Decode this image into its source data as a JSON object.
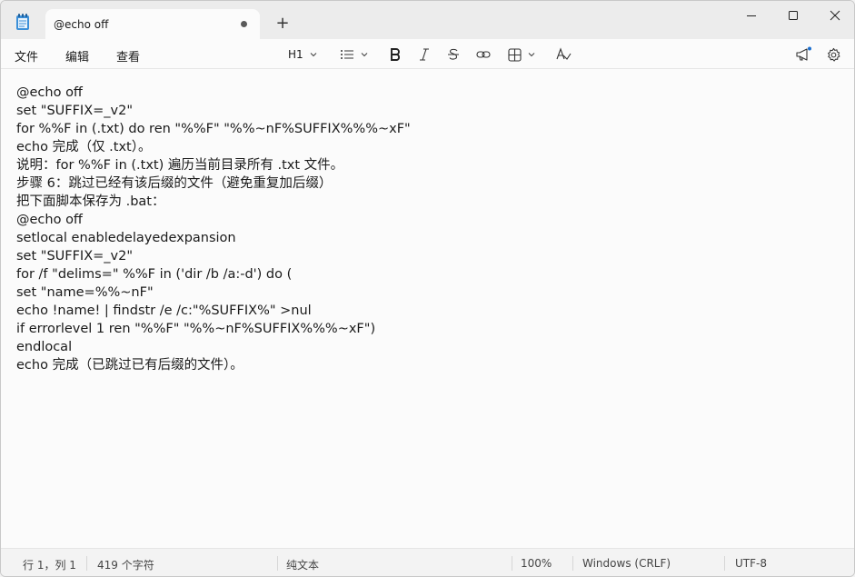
{
  "window": {
    "tab_title": "@echo off",
    "new_tab_symbol": "+"
  },
  "menu": {
    "file": "文件",
    "edit": "编辑",
    "view": "查看"
  },
  "toolbar": {
    "heading": "H1"
  },
  "editor": {
    "lines": [
      "@echo off",
      "set \"SUFFIX=_v2\"",
      "for %%F in (.txt) do ren \"%%F\" \"%%~nF%SUFFIX%%%~xF\"",
      "echo 完成（仅 .txt）。",
      "说明：for %%F in (.txt) 遍历当前目录所有 .txt 文件。",
      "步骤 6：跳过已经有该后缀的文件（避免重复加后缀）",
      "把下面脚本保存为 .bat：",
      "@echo off",
      "setlocal enabledelayedexpansion",
      "set \"SUFFIX=_v2\"",
      "for /f \"delims=\" %%F in ('dir /b /a:-d') do (",
      "set \"name=%%~nF\"",
      "echo !name! | findstr /e /c:\"%SUFFIX%\" >nul",
      "if errorlevel 1 ren \"%%F\" \"%%~nF%SUFFIX%%%~xF\")",
      "endlocal",
      "echo 完成（已跳过已有后缀的文件）。"
    ]
  },
  "status": {
    "position": "行 1，列 1",
    "chars": "419 个字符",
    "format": "纯文本",
    "zoom": "100%",
    "line_ending": "Windows (CRLF)",
    "encoding": "UTF-8"
  }
}
